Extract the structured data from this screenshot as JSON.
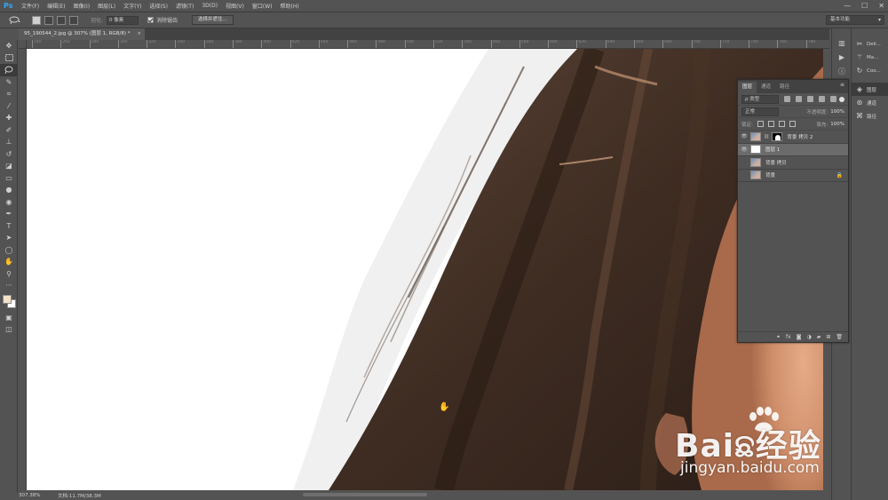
{
  "app": {
    "logo": "Ps"
  },
  "menu": [
    "文件(F)",
    "编辑(E)",
    "图像(I)",
    "图层(L)",
    "文字(Y)",
    "选择(S)",
    "滤镜(T)",
    "3D(D)",
    "视图(V)",
    "窗口(W)",
    "帮助(H)"
  ],
  "window_controls": {
    "minimize": "—",
    "maximize": "☐",
    "close": "✕"
  },
  "options": {
    "feather_label": "羽化:",
    "feather_value": "0 像素",
    "antialias_label": "消除锯齿",
    "antialias_checked": true,
    "select_mask_button": "选择并遮住...",
    "workspace": "基本功能"
  },
  "document_tab": {
    "title": "95_190544_2.jpg @ 307% (图层 1, RGB/8) *",
    "close": "×"
  },
  "ruler_h_labels": [
    "240",
    "260",
    "280",
    "300",
    "320",
    "340",
    "360",
    "380",
    "400",
    "420",
    "440",
    "460",
    "480",
    "500",
    "520",
    "540",
    "560",
    "580",
    "600",
    "620",
    "640",
    "660",
    "680",
    "700",
    "720",
    "740",
    "760",
    "780"
  ],
  "status": {
    "zoom": "307.38%",
    "doc": "文档:11.7M/38.3M"
  },
  "collapsed_panels": {
    "group1": [
      "Deli...",
      "Ma...",
      "Coo..."
    ],
    "group2": [
      "图层",
      "通道",
      "路径"
    ]
  },
  "layers_panel": {
    "tabs": [
      "图层",
      "通道",
      "路径"
    ],
    "filter_kind": "ρ 类型",
    "blend_mode": "正常",
    "opacity_label": "不透明度:",
    "opacity_value": "100%",
    "lock_label": "锁定:",
    "fill_label": "填充:",
    "fill_value": "100%",
    "layers": [
      {
        "name": "背景 拷贝 2",
        "visible": true,
        "has_mask": true,
        "selected": false,
        "thumb": "photo"
      },
      {
        "name": "图层 1",
        "visible": true,
        "has_mask": false,
        "selected": true,
        "thumb": "white"
      },
      {
        "name": "背景 拷贝",
        "visible": false,
        "has_mask": false,
        "selected": false,
        "thumb": "photo"
      },
      {
        "name": "背景",
        "visible": false,
        "has_mask": false,
        "selected": false,
        "thumb": "photo",
        "locked": true
      }
    ]
  },
  "watermark": {
    "brand": "Baiଛ经验",
    "url": "jingyan.baidu.com"
  },
  "colors": {
    "foreground": "#f5e2c8",
    "background": "#ffffff",
    "panel": "#535353",
    "accent": "#31a8ff"
  }
}
